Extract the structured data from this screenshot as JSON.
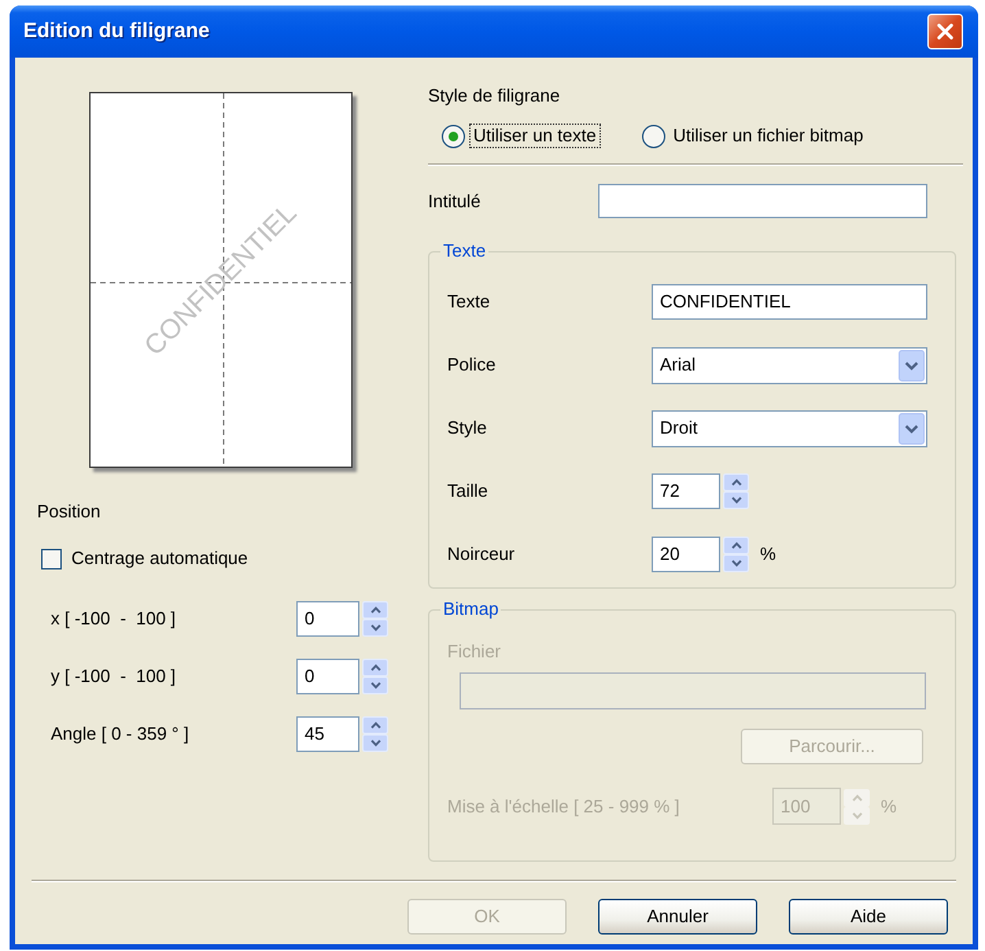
{
  "window": {
    "title": "Edition du filigrane"
  },
  "preview": {
    "watermark_text": "CONFIDENTIEL"
  },
  "position": {
    "title": "Position",
    "auto_center": {
      "label": "Centrage automatique",
      "checked": false
    },
    "fields": [
      {
        "label": "x [ -100  -  100 ]",
        "value": "0"
      },
      {
        "label": "y [ -100  -  100 ]",
        "value": "0"
      },
      {
        "label": "Angle [ 0 - 359 ° ]",
        "value": "45"
      }
    ]
  },
  "watermark_style": {
    "title": "Style de filigrane",
    "options": [
      {
        "label": "Utiliser un texte",
        "selected": true,
        "focused": true
      },
      {
        "label": "Utiliser un fichier bitmap",
        "selected": false,
        "focused": false
      }
    ]
  },
  "caption": {
    "label": "Intitulé"
  },
  "text_group": {
    "title": "Texte",
    "rows": [
      {
        "kind": "text",
        "label": "Texte",
        "value": "CONFIDENTIEL"
      },
      {
        "kind": "dropdown",
        "label": "Police",
        "value": "Arial"
      },
      {
        "kind": "dropdown",
        "label": "Style",
        "value": "Droit"
      },
      {
        "kind": "spinner",
        "label": "Taille",
        "value": "72"
      },
      {
        "kind": "spinner",
        "label": "Noirceur",
        "value": "20",
        "unit": "%"
      }
    ]
  },
  "bitmap_group": {
    "title": "Bitmap",
    "disabled": true,
    "file_label": "Fichier",
    "browse_button": "Parcourir...",
    "scale": {
      "label": "Mise à l'échelle [ 25 - 999 % ]",
      "value": "100",
      "unit": "%"
    }
  },
  "buttons": [
    {
      "label": "OK",
      "disabled": true
    },
    {
      "label": "Annuler",
      "disabled": false
    },
    {
      "label": "Aide",
      "disabled": false
    }
  ]
}
